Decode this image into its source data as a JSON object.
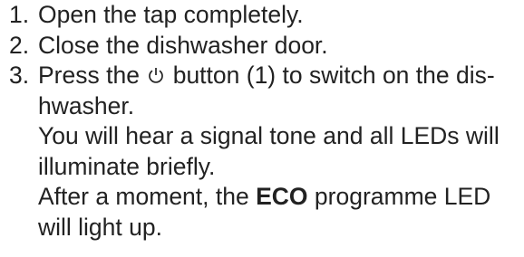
{
  "steps": [
    {
      "number": "1.",
      "text": "Open the tap completely."
    },
    {
      "number": "2.",
      "text": "Close the dishwasher door."
    },
    {
      "number": "3.",
      "line1_before_icon": "Press the",
      "icon": "power-icon",
      "line1_after_icon": "button (1) to switch on the dis-",
      "line2": "hwasher.",
      "line3": "You will hear a signal tone and all LEDs will",
      "line4": "illuminate briefly.",
      "line5_before_bold": "After a moment, the",
      "line5_bold": "ECO",
      "line5_after_bold": "programme LED",
      "line6": "will light up."
    }
  ]
}
